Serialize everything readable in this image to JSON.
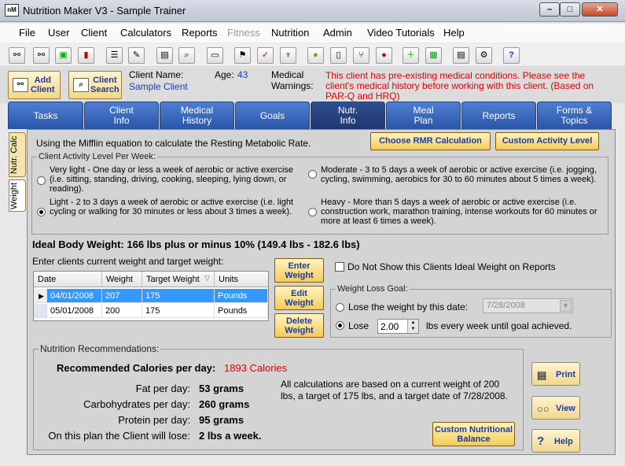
{
  "window": {
    "title": "Nutrition Maker V3 - Sample Trainer",
    "icon": "nM"
  },
  "menu": [
    {
      "label": "File",
      "enabled": true
    },
    {
      "label": "User",
      "enabled": true
    },
    {
      "label": "Client",
      "enabled": true
    },
    {
      "label": "Calculators",
      "enabled": true
    },
    {
      "label": "Reports",
      "enabled": true
    },
    {
      "label": "Fitness",
      "enabled": false
    },
    {
      "label": "Nutrition",
      "enabled": true
    },
    {
      "label": "Admin",
      "enabled": true
    },
    {
      "label": "Video Tutorials",
      "enabled": true
    },
    {
      "label": "Help",
      "enabled": true
    }
  ],
  "header": {
    "add_client": "Add\nClient",
    "client_search": "Client\nSearch",
    "client_name_label": "Client Name:",
    "client_name": "Sample Client",
    "age_label": "Age:",
    "age": "43",
    "warnings_label": "Medical\nWarnings:",
    "warnings": "This client has pre-existing medical conditions. Please see the client's medical history before working with this client.  (Based on PAR-Q and HRQ)"
  },
  "tabs": [
    {
      "label": "Tasks",
      "active": false
    },
    {
      "label": "Client\nInfo",
      "active": false
    },
    {
      "label": "Medical\nHistory",
      "active": false
    },
    {
      "label": "Goals",
      "active": false
    },
    {
      "label": "Nutr.\nInfo",
      "active": true
    },
    {
      "label": "Meal\nPlan",
      "active": false
    },
    {
      "label": "Reports",
      "active": false
    },
    {
      "label": "Forms &\nTopics",
      "active": false
    }
  ],
  "side_tabs": {
    "calc": "Nutr. Calc",
    "weight": "Weight"
  },
  "rmr": {
    "text": "Using the Mifflin equation to calculate the Resting Metabolic Rate.",
    "choose_btn": "Choose RMR Calculation",
    "custom_btn": "Custom Activity Level"
  },
  "activity": {
    "legend": "Client Activity Level Per Week:",
    "options": [
      {
        "text": "Very light - One day or less a week of aerobic or active exercise (i.e. sitting, standing, driving, cooking, sleeping, lying down, or reading).",
        "selected": false
      },
      {
        "text": "Moderate - 3 to 5 days a week of aerobic or active exercise (i.e. jogging, cycling, swimming, aerobics for 30 to 60 minutes about 5 times a week).",
        "selected": false
      },
      {
        "text": "Light - 2 to 3 days a week of aerobic or active exercise (i.e. light cycling or walking for 30 minutes or less about 3 times a week).",
        "selected": true
      },
      {
        "text": "Heavy - More than 5 days a week of aerobic or active exercise (i.e. construction work, marathon training, intense workouts for 60 minutes or more at least 6 times a week).",
        "selected": false
      }
    ]
  },
  "ideal_weight": "Ideal Body Weight: 166 lbs plus or minus 10% (149.4 lbs - 182.6 lbs)",
  "weight_entry_label": "Enter clients current weight and target weight:",
  "grid": {
    "columns": [
      "Date",
      "Weight",
      "Target Weight",
      "Units"
    ],
    "rows": [
      {
        "date": "04/01/2008",
        "weight": "207",
        "target": "175",
        "units": "Pounds"
      },
      {
        "date": "05/01/2008",
        "weight": "200",
        "target": "175",
        "units": "Pounds"
      }
    ]
  },
  "weight_buttons": {
    "enter": "Enter\nWeight",
    "edit": "Edit\nWeight",
    "delete": "Delete\nWeight"
  },
  "hide_ideal_label": "Do Not Show this Clients Ideal Weight on Reports",
  "weight_goal": {
    "legend": "Weight Loss Goal:",
    "by_date_label": "Lose the weight by this date:",
    "date_value": "7/28/2008",
    "lose_label": "Lose",
    "lose_value": "2.00",
    "lose_suffix": "lbs every week until goal achieved."
  },
  "recommendations": {
    "legend": "Nutrition Recommendations:",
    "calories_label": "Recommended Calories per day:",
    "calories_value": "1893 Calories",
    "fat_label": "Fat per day:",
    "fat_value": "53 grams",
    "carb_label": "Carbohydrates per day:",
    "carb_value": "260 grams",
    "protein_label": "Protein per day:",
    "protein_value": "95 grams",
    "lose_label": "On this plan the Client will lose:",
    "lose_value": "2 lbs a week.",
    "note": "All calculations are based on a current weight of 200 lbs, a target of 175 lbs, and a target date of 7/28/2008.",
    "custom_balance": "Custom Nutritional\nBalance"
  },
  "side_actions": {
    "print": "Print",
    "view": "View",
    "help": "Help"
  },
  "colors": {
    "accent_red": "#e00000",
    "link_blue": "#1a3ccc",
    "tab_blue": "#2a55a8"
  }
}
